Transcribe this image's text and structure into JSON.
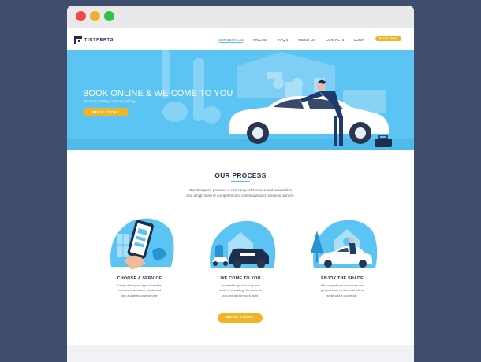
{
  "brand": {
    "name": "TINTPERTS"
  },
  "nav": {
    "items": [
      {
        "label": "OUR SERVICES"
      },
      {
        "label": "PRICING"
      },
      {
        "label": "FAQ'S"
      },
      {
        "label": "ABOUT US"
      },
      {
        "label": "CONTACTS"
      },
      {
        "label": "LOGIN"
      }
    ],
    "cta": "BOOK NOW"
  },
  "hero": {
    "title": "BOOK ONLINE & WE COME TO YOU",
    "subtitle": "No more waiting rooms or call log.",
    "cta": "BOOK TODAY"
  },
  "process": {
    "title": "OUR PROCESS",
    "description_lines": [
      "Our Company provides a vast range of services and capabilities",
      "and a high level of competence to individuals and business owners."
    ],
    "steps": [
      {
        "title": "CHOOSE A SERVICE",
        "lines": [
          "Easily select your type of vehicle,",
          "number of windows, shade and",
          "pick a date for your service."
        ]
      },
      {
        "title": "WE COME TO YOU",
        "lines": [
          "No need to go to a shop and",
          "avoid time waiting. We come to",
          "you and get the work done."
        ]
      },
      {
        "title": "ENJOY THE SHADE",
        "lines": [
          "We complete your windows and",
          "get you back on the road with a",
          "smile and a cooler car."
        ]
      }
    ],
    "cta": "BOOK TODAY"
  },
  "colors": {
    "accent": "#f0b429",
    "hero_bg": "#5bc4f2",
    "navy": "#1f2d4d",
    "backdrop": "#3f4e6e"
  }
}
